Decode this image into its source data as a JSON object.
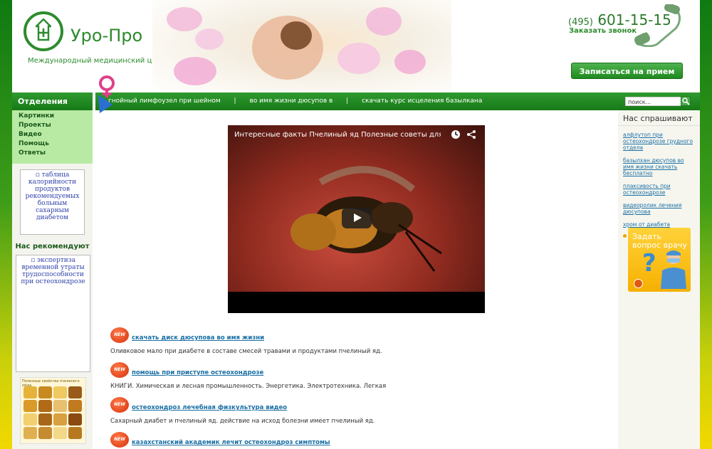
{
  "header": {
    "logo_text": "Уро-Про",
    "logo_sub": "Международный медицинский центр",
    "phone_code": "(495)",
    "phone_number": "601-15-15",
    "callback_label": "Заказать звонок",
    "appointment_button": "Записаться на прием"
  },
  "nav": {
    "left_title": "Отделения",
    "links": [
      "гнойный лимфоузел при шейном",
      "во имя жизни дюсупов в",
      "скачать курс исцеления базылкана"
    ],
    "separator": "|",
    "search_placeholder": "поиск..."
  },
  "left_menu": {
    "items": [
      "Картинки",
      "Проекты",
      "Видео",
      "Помощь",
      "Ответы"
    ],
    "ad1_alt": "таблица калорийности продуктов рекомендуемых больным сахарным диабетом",
    "recommend_title": "Нас рекомендуют",
    "ad2_alt": "экспертиза временной утраты трудоспособности при остеохондрозе",
    "honey_caption": "Полезные свойства пчелиного мёда"
  },
  "right_menu": {
    "title": "Нас спрашивают",
    "links": [
      "алфлутоп при остеохондрозе грудного отдела",
      "базылхан дюсупов во имя жизни скачать бесплатно",
      "плаксивость при остеохондрозе",
      "видеоролик лечения дюсупова",
      "хром от диабета"
    ],
    "ask_doctor": "Задать вопрос врачу"
  },
  "video": {
    "title": "Интересные факты Пчелиный яд Полезные советы для зд..."
  },
  "articles": {
    "badge": "NEW",
    "items": [
      {
        "link": "скачать диск дюсупова во имя жизни",
        "text": "Оливковое мало при диабете в составе смесей травами и продуктами пчелиный яд."
      },
      {
        "link": "помощь при приступе остеохондрозе",
        "text": "КНИГИ. Химическая и лесная промышленность. Энергетика. Электротехника. Легкая"
      },
      {
        "link": "остеохондроз лечебная физкультура видео",
        "text": "Сахарный диабет и пчелиный яд. действие на исход болезни имеет пчелиный яд."
      },
      {
        "link": "казахстанский академик лечит остеохондроз симптомы",
        "text": ""
      }
    ]
  },
  "colors": {
    "brand_green": "#2e8b2e",
    "nav_green": "#177a17",
    "link_blue": "#1a6fa5",
    "menu_bg": "#b9eaa4"
  }
}
